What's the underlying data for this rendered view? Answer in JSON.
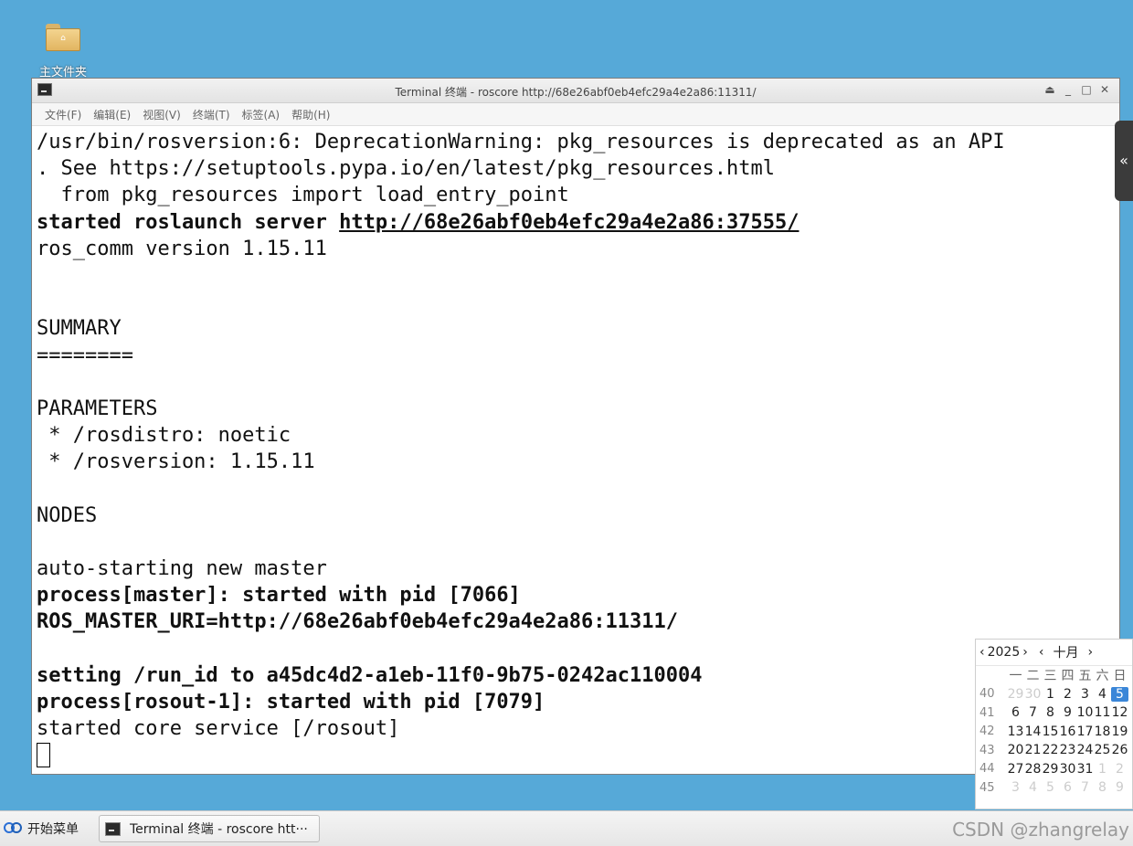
{
  "desktop": {
    "home_folder_label": "主文件夹"
  },
  "window": {
    "title": "Terminal 终端 - roscore http://68e26abf0eb4efc29a4e2a86:11311/",
    "controls": {
      "shade": "⏏",
      "minimize": "_",
      "maximize": "□",
      "close": "✕"
    },
    "menu": [
      "文件(F)",
      "编辑(E)",
      "视图(V)",
      "终端(T)",
      "标签(A)",
      "帮助(H)"
    ]
  },
  "terminal": {
    "lines": [
      {
        "text": "/usr/bin/rosversion:6: DeprecationWarning: pkg_resources is deprecated as an API"
      },
      {
        "text": ". See https://setuptools.pypa.io/en/latest/pkg_resources.html"
      },
      {
        "text": "  from pkg_resources import load_entry_point"
      },
      {
        "text": "started roslaunch server ",
        "link": "http://68e26abf0eb4efc29a4e2a86:37555/",
        "bold": true
      },
      {
        "text": "ros_comm version 1.15.11"
      },
      {
        "text": ""
      },
      {
        "text": ""
      },
      {
        "text": "SUMMARY"
      },
      {
        "text": "========"
      },
      {
        "text": ""
      },
      {
        "text": "PARAMETERS"
      },
      {
        "text": " * /rosdistro: noetic"
      },
      {
        "text": " * /rosversion: 1.15.11"
      },
      {
        "text": ""
      },
      {
        "text": "NODES"
      },
      {
        "text": ""
      },
      {
        "text": "auto-starting new master"
      },
      {
        "text": "process[master]: started with pid [7066]",
        "bold": true
      },
      {
        "text": "ROS_MASTER_URI=http://68e26abf0eb4efc29a4e2a86:11311/",
        "bold": true
      },
      {
        "text": ""
      },
      {
        "text": "setting /run_id to a45dc4d2-a1eb-11f0-9b75-0242ac110004",
        "bold": true
      },
      {
        "text": "process[rosout-1]: started with pid [7079]",
        "bold": true
      },
      {
        "text": "started core service [/rosout]"
      }
    ]
  },
  "side_handle": {
    "label": "«"
  },
  "calendar": {
    "year": "2025",
    "month": "十月",
    "prev": "‹",
    "next": "›",
    "weekdays": [
      "一",
      "二",
      "三",
      "四",
      "五",
      "六",
      "日"
    ],
    "weeks": [
      {
        "num": "40",
        "days": [
          "29",
          "30",
          "1",
          "2",
          "3",
          "4",
          "5"
        ],
        "dim": [
          0,
          1
        ],
        "today": 6
      },
      {
        "num": "41",
        "days": [
          "6",
          "7",
          "8",
          "9",
          "10",
          "11",
          "12"
        ],
        "dim": []
      },
      {
        "num": "42",
        "days": [
          "13",
          "14",
          "15",
          "16",
          "17",
          "18",
          "19"
        ],
        "dim": []
      },
      {
        "num": "43",
        "days": [
          "20",
          "21",
          "22",
          "23",
          "24",
          "25",
          "26"
        ],
        "dim": []
      },
      {
        "num": "44",
        "days": [
          "27",
          "28",
          "29",
          "30",
          "31",
          "1",
          "2"
        ],
        "dim": [
          5,
          6
        ]
      },
      {
        "num": "45",
        "days": [
          "3",
          "4",
          "5",
          "6",
          "7",
          "8",
          "9"
        ],
        "dim": [
          0,
          1,
          2,
          3,
          4,
          5,
          6
        ]
      }
    ]
  },
  "taskbar": {
    "start_label": "开始菜单",
    "task_label": "Terminal 终端 - roscore htt···",
    "watermark": "CSDN @zhangrelay"
  }
}
